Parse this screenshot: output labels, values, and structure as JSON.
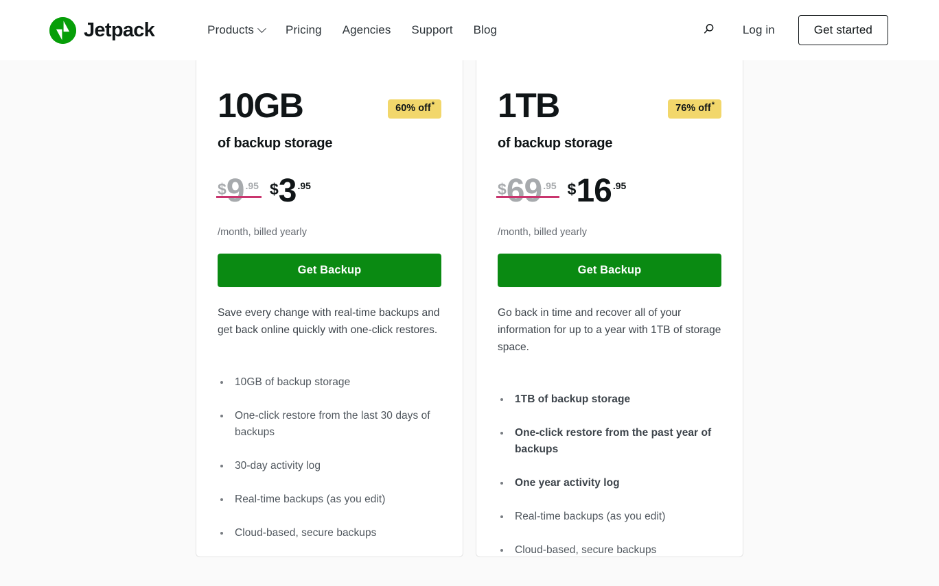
{
  "header": {
    "brand": {
      "name": "Jetpack",
      "logo_icon": "jetpack-bolt-icon",
      "logo_color": "#069e08"
    },
    "nav": [
      {
        "label": "Products",
        "has_dropdown": true
      },
      {
        "label": "Pricing",
        "has_dropdown": false
      },
      {
        "label": "Agencies",
        "has_dropdown": false
      },
      {
        "label": "Support",
        "has_dropdown": false
      },
      {
        "label": "Blog",
        "has_dropdown": false
      }
    ],
    "search_icon": "search-icon",
    "login_label": "Log in",
    "get_started_label": "Get started"
  },
  "colors": {
    "brand_green": "#069e08",
    "cta_green": "#0a8a12",
    "badge_yellow": "#f2d76b",
    "strike_crimson": "#c9356e",
    "page_background": "#fafafa"
  },
  "cards": [
    {
      "tier_size": "10GB",
      "tier_sub": "of backup storage",
      "badge": "60% off",
      "badge_star": "*",
      "price_old": {
        "currency": "$",
        "amount": "9",
        "cents": ".95"
      },
      "price_new": {
        "currency": "$",
        "amount": "3",
        "cents": ".95"
      },
      "billing_note": "/month, billed yearly",
      "cta_label": "Get Backup",
      "description": "Save every change with real-time backups and get back online quickly with one-click restores.",
      "features": [
        {
          "text": "10GB of backup storage",
          "bold": false
        },
        {
          "text": "One-click restore from the last 30 days of backups",
          "bold": false
        },
        {
          "text": "30-day activity log",
          "bold": false
        },
        {
          "text": "Real-time backups (as you edit)",
          "bold": false
        },
        {
          "text": "Cloud-based, secure backups",
          "bold": false
        }
      ]
    },
    {
      "tier_size": "1TB",
      "tier_sub": "of backup storage",
      "badge": "76% off",
      "badge_star": "*",
      "price_old": {
        "currency": "$",
        "amount": "69",
        "cents": ".95"
      },
      "price_new": {
        "currency": "$",
        "amount": "16",
        "cents": ".95"
      },
      "billing_note": "/month, billed yearly",
      "cta_label": "Get Backup",
      "description": "Go back in time and recover all of your information for up to a year with 1TB of storage space.",
      "features": [
        {
          "text": "1TB of backup storage",
          "bold": true
        },
        {
          "text": "One-click restore from the past year of backups",
          "bold": true
        },
        {
          "text": "One year activity log",
          "bold": true
        },
        {
          "text": "Real-time backups (as you edit)",
          "bold": false
        },
        {
          "text": "Cloud-based, secure backups",
          "bold": false
        }
      ]
    }
  ]
}
